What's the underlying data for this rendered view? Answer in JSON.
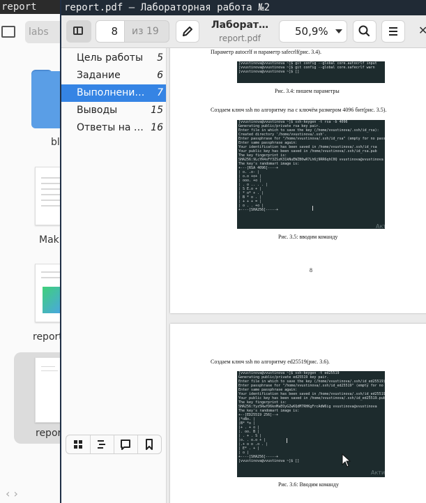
{
  "background_window": {
    "title": "report",
    "path": "labs",
    "items": [
      {
        "label": "bl"
      },
      {
        "label": "Mak"
      },
      {
        "label": "report"
      },
      {
        "label": "repor"
      }
    ]
  },
  "window": {
    "title": "report.pdf — Лабораторная работа №2"
  },
  "header": {
    "page_current": "8",
    "page_total": "из 19",
    "doc_title": "Лаборат…",
    "doc_subtitle": "report.pdf",
    "zoom": "50,9%"
  },
  "sidebar": {
    "items": [
      {
        "label": "Цель работы",
        "page": "5",
        "selected": false
      },
      {
        "label": "Задание",
        "page": "6",
        "selected": false
      },
      {
        "label": "Выполнение…",
        "page": "7",
        "selected": true
      },
      {
        "label": "Выводы",
        "page": "15",
        "selected": false
      },
      {
        "label": "Ответы на к…",
        "page": "16",
        "selected": false
      }
    ]
  },
  "page8": {
    "top_text": "Параметр autocrlf и параметр safecrlf(рис. 3.4).",
    "term1": [
      "[vvustinova@vvustinova ~]$ git config --global core.autocrlf input",
      "[vvustinova@vvustinova ~]$ git config --global core.safecrlf warn",
      "[vvustinova@vvustinova ~]$ []"
    ],
    "caption1": "Рис. 3.4: пишем параметры",
    "para2": "Создаем ключ ssh по алгоритму rsa с ключём размером 4096 бит(рис. 3.5).",
    "term2": [
      "[vvustinova@vvustinova ~]$ ssh-keygen -t rsa -b 4096",
      "Generating public/private rsa key pair.",
      "Enter file in which to save the key (/home/vvustinova/.ssh/id_rsa):",
      "Created directory '/home/vvustinova/.ssh'.",
      "Enter passphrase for \"/home/vvustinova/.ssh/id_rsa\" (empty for no passphrase):",
      "Enter same passphrase again:",
      "Your identification has been saved in /home/vvustinova/.ssh/id_rsa",
      "Your public key has been saved in /home/vvustinova/.ssh/id_rsa.pub",
      "The key fingerprint is:",
      "SHA256:9LcYR4sFf3ZSzK31kNuEWZB0wR7Lh6j9RR6qhC0Q vvustinova@vvustinova",
      "The key's randomart image is:",
      "+---[RSA 4096]----+",
      "|        o.   .o- |",
      "|       o.o  +o+  |",
      "|       ooo.  +o  |",
      "|      . o .. . . |",
      "|        S E.o +  |",
      "|       * o* + .  |",
      "|        B * o .  |",
      "|       + + + =   |",
      "|        o . . +o |",
      "+----[SHA256]-----+"
    ],
    "caption2": "Рис. 3.5: вводим команду",
    "page_number": "8"
  },
  "page9": {
    "para": "Создаем ключ ssh по алгоритму ed25519(рис. 3.6).",
    "term": [
      "[vvustinova@vvustinova ~]$ ssh-keygen -t ed25519",
      "Generating public/private ed25519 key pair.",
      "Enter file in which to save the key (/home/vvustinova/.ssh/id_ed25519):",
      "Enter passphrase for \"/home/vvustinova/.ssh/id_ed25519\" (empty for no passphrase):",
      "Enter same passphrase again:",
      "Your identification has been saved in /home/vvustinova/.ssh/id_ed25519",
      "Your public key has been saved in /home/vvustinova/.ssh/id_ed25519.pub",
      "The key fingerprint is:",
      "SHA256:Yyz5RwfD6knMaEOyGZwKQdM7RHKgFrcAdW6ig vvustinova@vvustinova",
      "The key's randomart image is:",
      "+--[ED25519 256]--+",
      "|*oBo.            |",
      "|B* *o            |",
      "|+ . + o          |",
      "|. oo. B          |",
      "|  .   + . S      |",
      "|o.   . o.o +     |",
      "|.+ o o .o .      |",
      "| E* . +          |",
      "|   o             |",
      "+----[SHA256]-----+",
      "[vvustinova@vvustinova ~]$ []"
    ],
    "caption": "Рис. 3.6: Вводим команду"
  },
  "watermark": "Акти"
}
